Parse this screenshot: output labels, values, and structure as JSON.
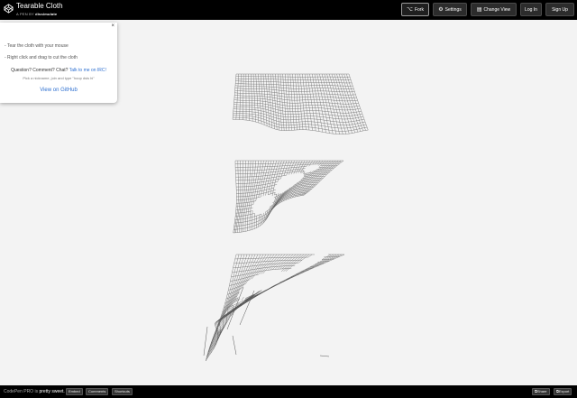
{
  "header": {
    "title": "Tearable Cloth",
    "byline_prefix": "A PEN BY",
    "author": "dissimulate",
    "buttons": {
      "fork": "Fork",
      "settings": "Settings",
      "change_view": "Change View",
      "login": "Log In",
      "signup": "Sign Up"
    }
  },
  "panel": {
    "close": "×",
    "tip1": "- Tear the cloth with your mouse",
    "tip2": "- Right click and drag to cut the cloth",
    "question": "Question? Comment? Chat?",
    "question_link": "Talk to me on IRC!",
    "hint": "Pick a nickname, join and type \"hoop dsis hi\"",
    "github": "View on GitHub"
  },
  "footer": {
    "pro_text": "CodePen PRO is",
    "pro_sweet": "pretty sweet.",
    "embed": "Embed",
    "comments": "Comments",
    "shortcuts": "Shortcuts",
    "share": "Share",
    "export": "Export"
  },
  "colors": {
    "topbar": "#000000",
    "stage": "#f3f3f3",
    "link": "#2d6fd0",
    "cloth": "#555555"
  },
  "icons": [
    "codepen-logo-icon",
    "fork-icon",
    "gear-icon",
    "layout-icon",
    "close-icon",
    "share-icon",
    "export-icon"
  ]
}
